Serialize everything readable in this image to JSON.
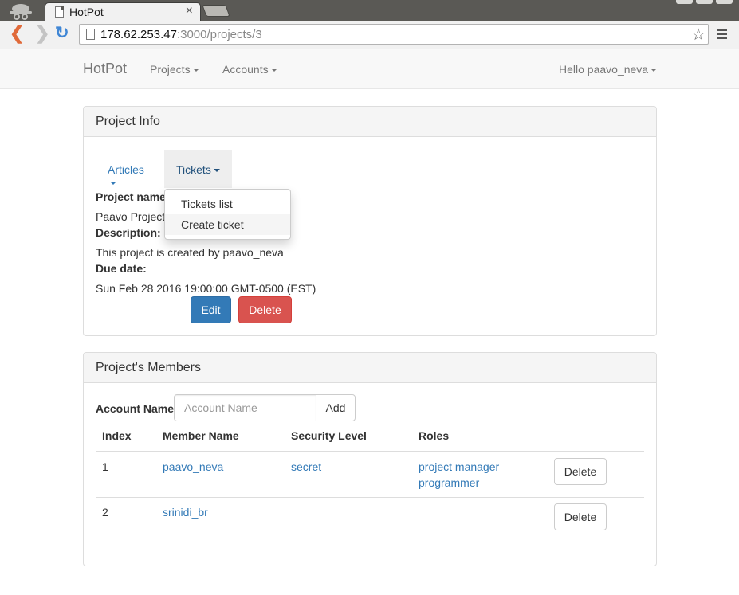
{
  "browser": {
    "tab_title": "HotPot",
    "url_host": "178.62.253.47",
    "url_path": ":3000/projects/3"
  },
  "navbar": {
    "brand": "HotPot",
    "projects": "Projects",
    "accounts": "Accounts",
    "user": "Hello paavo_neva"
  },
  "project_info": {
    "heading": "Project Info",
    "pills": {
      "articles": "Articles",
      "tickets": "Tickets"
    },
    "tickets_menu": [
      "Tickets list",
      "Create ticket"
    ],
    "name_label": "Project name",
    "name_value": "Paavo Project",
    "description_label": "Description:",
    "description_value": "This project is created by paavo_neva",
    "due_label": "Due date:",
    "due_value": "Sun Feb 28 2016 19:00:00 GMT-0500 (EST)",
    "edit_label": "Edit",
    "delete_label": "Delete"
  },
  "members": {
    "heading": "Project's Members",
    "account_label": "Account Name",
    "account_placeholder": "Account Name",
    "add_label": "Add",
    "columns": [
      "Index",
      "Member Name",
      "Security Level",
      "Roles"
    ],
    "rows": [
      {
        "index": "1",
        "name": "paavo_neva",
        "security": "secret",
        "roles": [
          "project manager",
          "programmer"
        ],
        "action": "Delete"
      },
      {
        "index": "2",
        "name": "srinidi_br",
        "security": "",
        "roles": [],
        "action": "Delete"
      }
    ]
  },
  "colors": {
    "primary": "#337ab7",
    "danger": "#d9534f",
    "link": "#337ab7"
  }
}
